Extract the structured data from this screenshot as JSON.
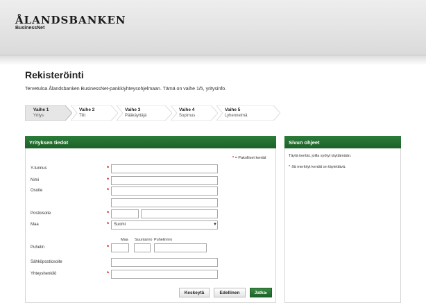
{
  "header": {
    "brand": "ÅLANDSBANKEN",
    "product": "BusinessNet"
  },
  "page": {
    "title": "Rekisteröinti",
    "intro": "Tervetuloa Ålandsbanken BusinessNet-pankkiyhteysohjelmaan. Tämä on vaihe 1/5, yritysinfo."
  },
  "steps": [
    {
      "title": "Vaihe 1",
      "subtitle": "Yritys",
      "active": true
    },
    {
      "title": "Vaihe 2",
      "subtitle": "Tilit",
      "active": false
    },
    {
      "title": "Vaihe 3",
      "subtitle": "Pääkäyttäjä",
      "active": false
    },
    {
      "title": "Vaihe 4",
      "subtitle": "Sopimus",
      "active": false
    },
    {
      "title": "Vaihe 5",
      "subtitle": "Lyhennelmä",
      "active": false
    }
  ],
  "form": {
    "heading": "Yrityksen tiedot",
    "required_mark": "*",
    "required_note": "= Pakolliset kentät",
    "labels": {
      "ytunnus": "Y-tunnus",
      "nimi": "Nimi",
      "osoite": "Osoite",
      "postiosoite": "Postiosoite",
      "maa": "Maa",
      "puhelin": "Puhelin",
      "sahkoposti": "Sähköpostiosoite",
      "yhteyshenkilo": "Yhteyshenkilö"
    },
    "fields": {
      "ytunnus": "",
      "nimi": "",
      "osoite1": "",
      "osoite2": "",
      "postinumero": "",
      "postitoimipaikka": "",
      "maa": "Suomi",
      "puh_maa": "",
      "puh_suuntanro": "",
      "puh_numero": "",
      "sahkoposti": "",
      "yhteyshenkilo": ""
    },
    "phone_sublabels": {
      "maa": "Maa",
      "suuntanro": "Suuntanro",
      "puhelinnro": "Puhelinnro"
    }
  },
  "help": {
    "heading": "Sivun ohjeet",
    "line1": "Täytä kentät, joilla syötyt täyttämään.",
    "line2": "* :llä merkityt kentät on täytettävä."
  },
  "buttons": {
    "cancel": "Keskeytä",
    "previous": "Edellinen",
    "next": "Jatka›"
  },
  "colors": {
    "accent": "#1d6129",
    "required": "#d51b1b"
  }
}
